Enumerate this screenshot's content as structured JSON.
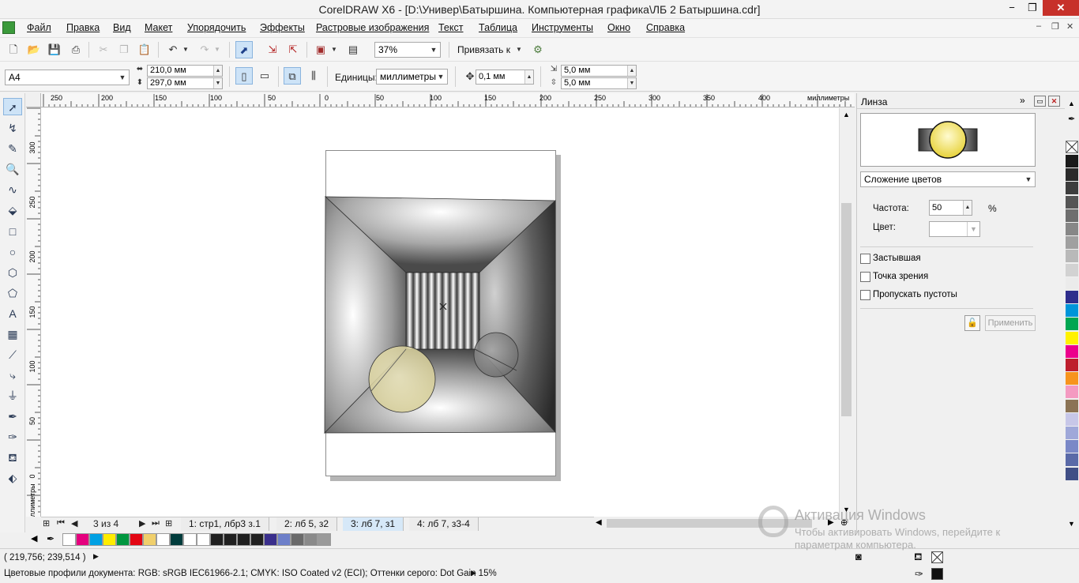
{
  "window": {
    "title": "CorelDRAW X6 - [D:\\Универ\\Батыршина. Компьютерная графика\\ЛБ 2 Батыршина.cdr]",
    "minimize": "−",
    "maximize": "❐",
    "close": "✕"
  },
  "menu": {
    "items": [
      "Файл",
      "Правка",
      "Вид",
      "Макет",
      "Упорядочить",
      "Эффекты",
      "Растровые изображения",
      "Текст",
      "Таблица",
      "Инструменты",
      "Окно",
      "Справка"
    ],
    "doc_min": "‒",
    "doc_restore": "❐",
    "doc_close": "✕"
  },
  "toolbar1": {
    "zoom_value": "37%",
    "snap_label": "Привязать к"
  },
  "toolbar2": {
    "paper_size": "A4",
    "width": "210,0 мм",
    "height": "297,0 мм",
    "units_label": "Единицы:",
    "units_value": "миллиметры",
    "nudge": "0,1 мм",
    "dup_x": "5,0 мм",
    "dup_y": "5,0 мм"
  },
  "ruler_top": {
    "ticks": [
      "250",
      "200",
      "150",
      "100",
      "50",
      "0",
      "50",
      "100",
      "150",
      "200",
      "250",
      "300",
      "350",
      "400"
    ],
    "units": "миллиметры"
  },
  "ruler_left": {
    "ticks": [
      "300",
      "250",
      "200",
      "150",
      "100",
      "50",
      "0"
    ],
    "units": "миллиметры"
  },
  "pages": {
    "counter": "3 из 4",
    "tabs": [
      "1: стр1, лбр3 з.1",
      "2: лб 5, з2",
      "3: лб 7, з1",
      "4: лб 7, з3-4"
    ],
    "active_tab": 2
  },
  "doc_palette": {
    "colors": [
      "#ffffff",
      "#e5007e",
      "#00a0e3",
      "#ffed00",
      "#00963f",
      "#e30613",
      "#f0cf6b",
      "#ffffff",
      "#003c3c",
      "#ffffff",
      "#ffffff",
      "#202020",
      "#202020",
      "#202020",
      "#202020",
      "#3a2f8c",
      "#6d7fc9",
      "#6a6a6a",
      "#8a8a8a",
      "#9a9a9a"
    ]
  },
  "status": {
    "coords": "( 219,756; 239,514 )",
    "profiles": "Цветовые профили документа: RGB: sRGB IEC61966-2.1; CMYK: ISO Coated v2 (ECI); Оттенки серого: Dot Gain 15%"
  },
  "docker": {
    "title": "Линза",
    "lens_type": "Сложение цветов",
    "rate_label": "Частота:",
    "rate_value": "50",
    "rate_unit": "%",
    "color_label": "Цвет:",
    "frozen": "Застывшая",
    "viewpoint": "Точка зрения",
    "remove_face": "Пропускать пустоты",
    "apply": "Применить"
  },
  "palette": {
    "colors": [
      "#1a1a1a",
      "#2b2b2b",
      "#3d3d3d",
      "#555555",
      "#6e6e6e",
      "#878787",
      "#a0a0a0",
      "#b9b9b9",
      "#d2d2d2",
      "#ebebeb",
      "#2e2d8c",
      "#0095d9",
      "#00a651",
      "#fff200",
      "#ec008c",
      "#be1e2d",
      "#f7941d",
      "#f49ac1",
      "#8b7355",
      "#c7c7e8",
      "#9fa8d9",
      "#7a88c7",
      "#5a6aa8",
      "#404f86"
    ]
  },
  "watermark": {
    "title": "Активация Windows",
    "text": "Чтобы активировать Windows, перейдите к параметрам компьютера."
  }
}
